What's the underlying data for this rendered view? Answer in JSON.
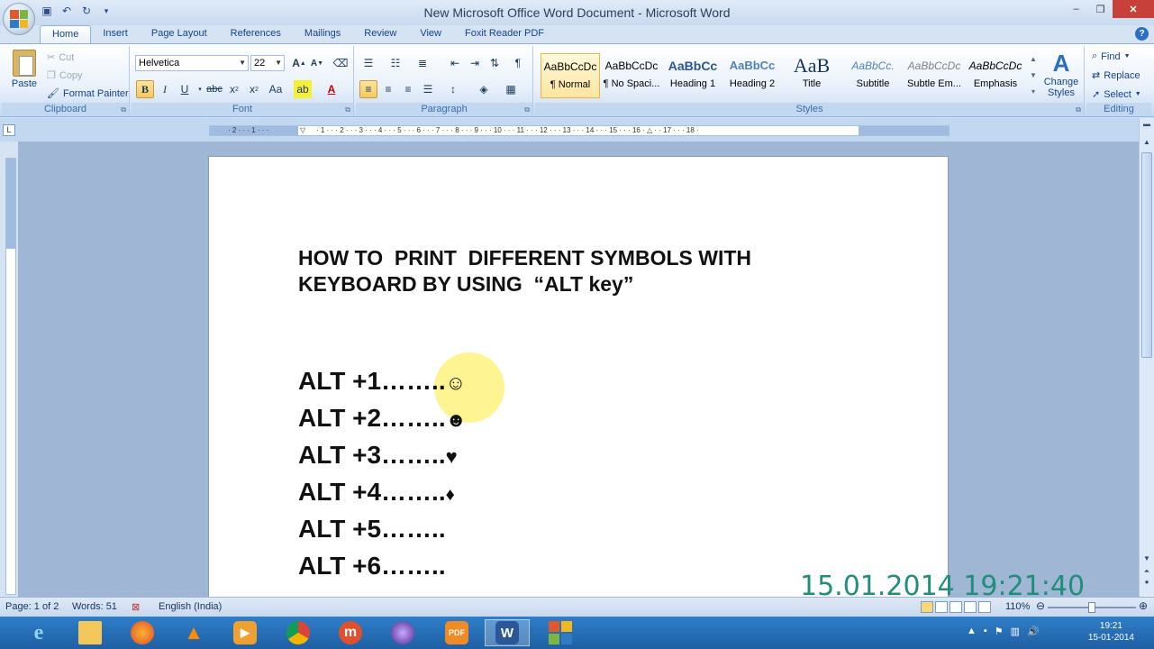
{
  "window": {
    "title": "New Microsoft Office Word Document - Microsoft Word",
    "controls": [
      "–",
      "❐",
      "✕"
    ]
  },
  "quick_access": {
    "save_icon": "save-icon",
    "undo_icon": "undo-icon",
    "redo_icon": "redo-icon"
  },
  "tabs": [
    "Home",
    "Insert",
    "Page Layout",
    "References",
    "Mailings",
    "Review",
    "View",
    "Foxit Reader PDF"
  ],
  "active_tab": "Home",
  "help": "?",
  "ribbon": {
    "clipboard": {
      "label": "Clipboard",
      "paste": "Paste",
      "cut": "Cut",
      "copy": "Copy",
      "format_painter": "Format Painter"
    },
    "font": {
      "label": "Font",
      "font_name": "Helvetica",
      "font_size": "22"
    },
    "paragraph": {
      "label": "Paragraph"
    },
    "styles": {
      "label": "Styles",
      "items": [
        {
          "sample": "AaBbCcDc",
          "name": "¶ Normal"
        },
        {
          "sample": "AaBbCcDc",
          "name": "¶ No Spaci..."
        },
        {
          "sample": "AaBbCc",
          "name": "Heading 1"
        },
        {
          "sample": "AaBbCc",
          "name": "Heading 2"
        },
        {
          "sample": "AaB",
          "name": "Title"
        },
        {
          "sample": "AaBbCc.",
          "name": "Subtitle"
        },
        {
          "sample": "AaBbCcDc",
          "name": "Subtle Em..."
        },
        {
          "sample": "AaBbCcDc",
          "name": "Emphasis"
        }
      ],
      "change_styles": "Change Styles"
    },
    "editing": {
      "label": "Editing",
      "find": "Find",
      "replace": "Replace",
      "select": "Select"
    }
  },
  "document": {
    "heading_line1": "HOW TO  PRINT  DIFFERENT SYMBOLS WITH",
    "heading_line2": "KEYBOARD BY USING  “ALT key”",
    "lines": [
      {
        "text": "ALT +1……..",
        "symbol": "☺"
      },
      {
        "text": "ALT +2……..",
        "symbol": "☻"
      },
      {
        "text": "ALT +3……..",
        "symbol": "♥"
      },
      {
        "text": "ALT +4……..",
        "symbol": "♦"
      },
      {
        "text": "ALT +5……..",
        "symbol": ""
      },
      {
        "text": "ALT +6……..",
        "symbol": ""
      }
    ],
    "overlay_timestamp": "15.01.2014 19:21:40"
  },
  "status": {
    "page": "Page: 1 of 2",
    "words": "Words: 51",
    "language": "English (India)",
    "zoom": "110%"
  },
  "taskbar": {
    "time": "19:21",
    "date": "15-01-2014",
    "apps": [
      "internet-explorer",
      "file-explorer",
      "firefox",
      "vlc",
      "media-player",
      "chrome",
      "meetup-m",
      "eclipse-orb",
      "pdf-reader",
      "word",
      "office-tiles"
    ]
  },
  "colors": {
    "accent": "#2b579a",
    "ribbon": "#dfeaf7",
    "timestamp": "#1f8e7a",
    "highlight": "#fff06e",
    "taskbar": "#2f7ec9"
  }
}
